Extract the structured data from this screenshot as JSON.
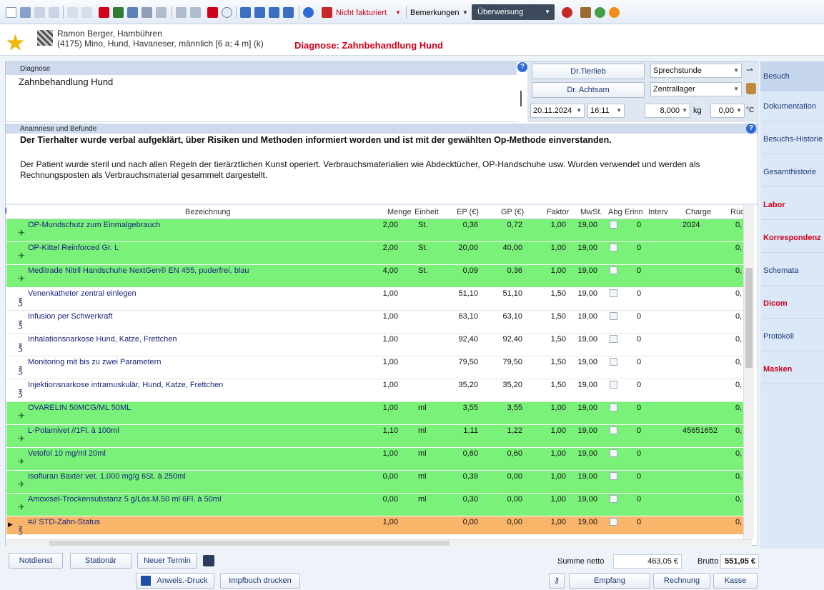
{
  "toolbar": {
    "billing_status": "Nicht fakturiert",
    "remarks_label": "Bemerkungen",
    "transfer_label": "Überweisung"
  },
  "patient": {
    "owner": "Ramon Berger, Hambühren",
    "animal": "(4175) Mino, Hund, Havaneser, männlich [6 a; 4 m] (k)",
    "diagnosis_banner": "Diagnose: Zahnbehandlung Hund"
  },
  "diagnosis": {
    "label": "Diagnose",
    "value": "Zahnbehandlung Hund"
  },
  "visit": {
    "doctor1": "Dr.Tierlieb",
    "doctor2": "Dr. Achtsam",
    "type": "Sprechstunde",
    "storage": "Zentrallager",
    "date": "20.11.2024",
    "time": "16:11",
    "weight": "8,000",
    "weight_unit": "kg",
    "temp": "0,00",
    "temp_unit": "°C"
  },
  "anamnesis": {
    "label": "Anamnese und Befunde",
    "bold_text": "Der Tierhalter wurde verbal aufgeklärt, über Risiken und Methoden informiert worden und ist mit der gewählten Op-Methode einverstanden.",
    "text": "Der Patient wurde steril und nach allen Regeln der tierärztlichen Kunst operiert. Verbrauchsmaterialien wie Abdecktücher, OP-Handschuhe usw. Wurden verwendet und werden als Rechnungsposten als Verbrauchsmaterial gesammelt dargestellt."
  },
  "table": {
    "headers": [
      "Bezeichnung",
      "Menge",
      "Einheit",
      "EP (€)",
      "GP (€)",
      "Faktor",
      "MwSt.",
      "Abg",
      "Erinn",
      "Interv",
      "Charge",
      "Rücl"
    ],
    "rows": [
      {
        "name": "OP-Mundschutz zum Einmalgebrauch",
        "menge": "2,00",
        "einheit": "St.",
        "ep": "0,36",
        "gp": "0,72",
        "faktor": "1,00",
        "mwst": "19,00",
        "erinn": "0",
        "charge": "2024",
        "rueck": "0,",
        "color": "green",
        "icon": "medicine"
      },
      {
        "name": "OP-Kittel Reinforced Gr. L",
        "menge": "2,00",
        "einheit": "St.",
        "ep": "20,00",
        "gp": "40,00",
        "faktor": "1,00",
        "mwst": "19,00",
        "erinn": "0",
        "charge": "",
        "rueck": "0,",
        "color": "green",
        "icon": "medicine"
      },
      {
        "name": "Meditrade Nitril Handschuhe NextGen® EN 455, puderfrei, blau",
        "menge": "4,00",
        "einheit": "St.",
        "ep": "0,09",
        "gp": "0,36",
        "faktor": "1,00",
        "mwst": "19,00",
        "erinn": "0",
        "charge": "",
        "rueck": "0,",
        "color": "green",
        "icon": "medicine"
      },
      {
        "name": "Venenkatheter zentral einlegen",
        "menge": "1,00",
        "einheit": "",
        "ep": "51,10",
        "gp": "51,10",
        "faktor": "1,50",
        "mwst": "19,00",
        "erinn": "0",
        "charge": "",
        "rueck": "0,",
        "color": "white",
        "icon": "service"
      },
      {
        "name": "Infusion per Schwerkraft",
        "menge": "1,00",
        "einheit": "",
        "ep": "63,10",
        "gp": "63,10",
        "faktor": "1,50",
        "mwst": "19,00",
        "erinn": "0",
        "charge": "",
        "rueck": "0,",
        "color": "white",
        "icon": "service"
      },
      {
        "name": "Inhalationsnarkose Hund, Katze, Frettchen",
        "menge": "1,00",
        "einheit": "",
        "ep": "92,40",
        "gp": "92,40",
        "faktor": "1,50",
        "mwst": "19,00",
        "erinn": "0",
        "charge": "",
        "rueck": "0,",
        "color": "white",
        "icon": "service"
      },
      {
        "name": "Monitoring mit bis zu zwei Parametern",
        "menge": "1,00",
        "einheit": "",
        "ep": "79,50",
        "gp": "79,50",
        "faktor": "1,50",
        "mwst": "19,00",
        "erinn": "0",
        "charge": "",
        "rueck": "0,",
        "color": "white",
        "icon": "service"
      },
      {
        "name": "Injektionsnarkose intramuskulär, Hund, Katze, Frettchen",
        "menge": "1,00",
        "einheit": "",
        "ep": "35,20",
        "gp": "35,20",
        "faktor": "1,50",
        "mwst": "19,00",
        "erinn": "0",
        "charge": "",
        "rueck": "0,",
        "color": "white",
        "icon": "service"
      },
      {
        "name": "OVARELIN 50MCG/ML 50ML",
        "menge": "1,00",
        "einheit": "ml",
        "ep": "3,55",
        "gp": "3,55",
        "faktor": "1,00",
        "mwst": "19,00",
        "erinn": "0",
        "charge": "",
        "rueck": "0,",
        "color": "green",
        "icon": "medicine"
      },
      {
        "name": "L-Polamivet //1Fl. à 100ml",
        "menge": "1,10",
        "einheit": "ml",
        "ep": "1,11",
        "gp": "1,22",
        "faktor": "1,00",
        "mwst": "19,00",
        "erinn": "0",
        "charge": "45651652",
        "rueck": "0,",
        "color": "green",
        "icon": "medicine"
      },
      {
        "name": "Vetofol 10 mg/ml 20ml",
        "menge": "1,00",
        "einheit": "ml",
        "ep": "0,60",
        "gp": "0,60",
        "faktor": "1,00",
        "mwst": "19,00",
        "erinn": "0",
        "charge": "",
        "rueck": "0,",
        "color": "green",
        "icon": "medicine"
      },
      {
        "name": "Isofluran Baxter vet. 1.000 mg/g 6St. à 250ml",
        "menge": "0,00",
        "einheit": "ml",
        "ep": "0,39",
        "gp": "0,00",
        "faktor": "1,00",
        "mwst": "19,00",
        "erinn": "0",
        "charge": "",
        "rueck": "0,",
        "color": "green",
        "icon": "medicine"
      },
      {
        "name": "Amoxisel-Trockensubstanz 5 g/Lös.M.50 ml 6Fl. à 50ml",
        "menge": "0,00",
        "einheit": "ml",
        "ep": "0,30",
        "gp": "0,00",
        "faktor": "1,00",
        "mwst": "19,00",
        "erinn": "0",
        "charge": "",
        "rueck": "0,",
        "color": "green",
        "icon": "medicine"
      },
      {
        "name": "#// STD-Zahn-Status",
        "menge": "1,00",
        "einheit": "",
        "ep": "0,00",
        "gp": "0,00",
        "faktor": "1,00",
        "mwst": "19,00",
        "erinn": "0",
        "charge": "",
        "rueck": "0,",
        "color": "orange",
        "icon": "service"
      }
    ]
  },
  "side_tabs": [
    {
      "label": "Besuch",
      "color": "#1d3a78",
      "selected": true
    },
    {
      "label": "Dokumentation",
      "color": "#1d3a78"
    },
    {
      "label": "Besuchs-Historie",
      "color": "#1d3a78"
    },
    {
      "label": "Gesamthistorie",
      "color": "#1d3a78"
    },
    {
      "label": "Labor",
      "color": "#d0021b"
    },
    {
      "label": "Korrespondenz",
      "color": "#d0021b"
    },
    {
      "label": "Schemata",
      "color": "#1d3a78"
    },
    {
      "label": "Dicom",
      "color": "#d0021b"
    },
    {
      "label": "Protokoll",
      "color": "#1d3a78"
    },
    {
      "label": "Masken",
      "color": "#d0021b"
    }
  ],
  "footer": {
    "notdienst": "Notdienst",
    "stationaer": "Stationär",
    "neuer_termin": "Neuer Termin",
    "anweis_druck": "Anweis.-Druck",
    "impfbuch": "Impfbuch drucken",
    "summe_label": "Summe netto",
    "summe": "463,05 €",
    "brutto_label": "Brutto",
    "brutto": "551,05 €",
    "empfang": "Empfang",
    "rechnung": "Rechnung",
    "kasse": "Kasse"
  }
}
